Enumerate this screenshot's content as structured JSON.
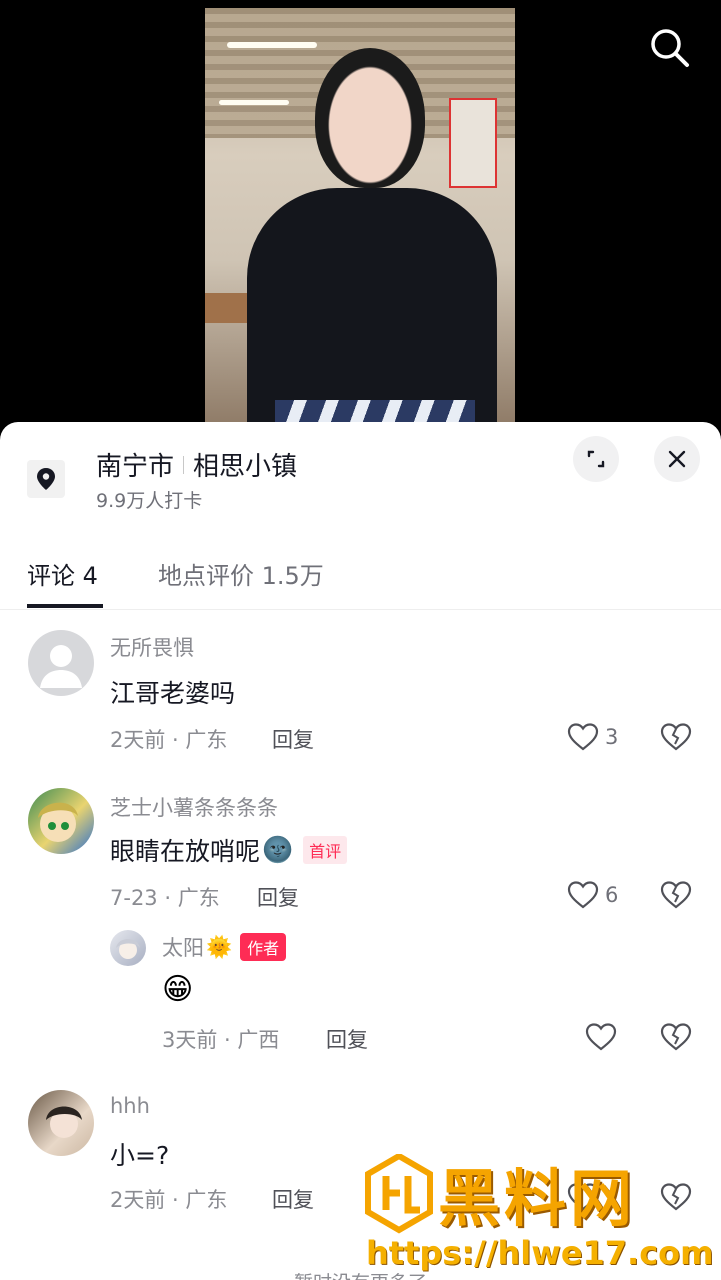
{
  "video": {
    "search_icon": "search-icon"
  },
  "location": {
    "city": "南宁市",
    "place": "相思小镇",
    "checkins": "9.9万人打卡",
    "pin_icon": "location-pin-icon",
    "expand_icon": "expand-icon",
    "close_icon": "close-icon"
  },
  "tabs": [
    {
      "label": "评论 4",
      "active": true
    },
    {
      "label": "地点评价 1.5万",
      "active": false
    }
  ],
  "comments": [
    {
      "user": "无所畏惧",
      "text": "江哥老婆吗",
      "time": "2天前",
      "region": "广东",
      "reply_label": "回复",
      "likes": "3"
    },
    {
      "user": "芝士小薯条条条条",
      "text": "眼睛在放哨呢",
      "emoji": "🌚",
      "badge": "首评",
      "time": "7-23",
      "region": "广东",
      "reply_label": "回复",
      "likes": "6",
      "replies": [
        {
          "user": "太阳",
          "user_emoji": "🌞",
          "badge": "作者",
          "text": "😁",
          "time": "3天前",
          "region": "广西",
          "reply_label": "回复"
        }
      ]
    },
    {
      "user": "hhh",
      "text": "小=?",
      "time": "2天前",
      "region": "广东",
      "reply_label": "回复"
    }
  ],
  "end_note": "暂时没有更多了",
  "watermark": {
    "brand": "黑料网",
    "url": "https://hlwe17.com"
  },
  "colors": {
    "accent": "#fe2c55",
    "text_primary": "#161823",
    "text_secondary": "#8a8b91",
    "watermark": "#f5a400"
  }
}
